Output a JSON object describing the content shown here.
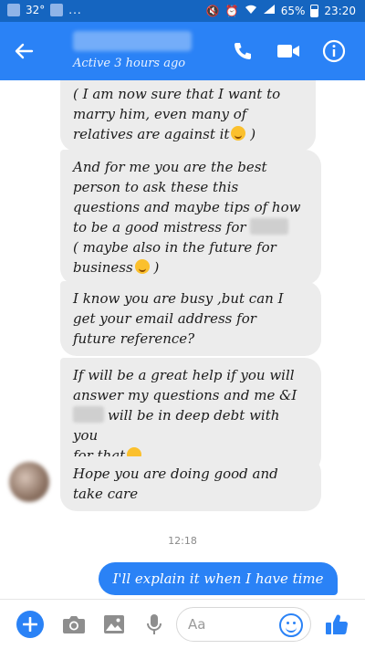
{
  "status_bar": {
    "temperature": "32°",
    "overflow_dots": "...",
    "battery_percent": "65%",
    "time": "23:20"
  },
  "header": {
    "status": "Active 3 hours ago",
    "icons": [
      "back-arrow-icon",
      "phone-icon",
      "video-camera-icon",
      "info-icon"
    ]
  },
  "messages": [
    {
      "id": "m1",
      "side": "received",
      "text": "( I am now sure that I want to\nmarry him, even many of\nrelatives are against it",
      "emoji": "winking-tongue-emoji",
      "after": " )"
    },
    {
      "id": "m2",
      "side": "received",
      "text": "And for me you are the best\nperson to ask these this\nquestions and maybe tips of how\nto be a good mistress for",
      "line2": "( maybe also in the future for\nbusiness",
      "emoji": "winking-tongue-emoji",
      "after": " )"
    },
    {
      "id": "m3",
      "side": "received",
      "text": "I know you are busy ,but can I\nget your email address for\nfuture reference?"
    },
    {
      "id": "m4",
      "side": "received",
      "text": "If will be a great help if you will\nanswer my questions and me &I",
      "line2": "will be in deep debt with you\nfor that",
      "emoji": "smiling-emoji"
    },
    {
      "id": "m5",
      "side": "received",
      "text": "Hope you are doing good and\ntake care"
    }
  ],
  "timestamp": "12:18",
  "sent_message": "I'll explain it when I have time",
  "composer": {
    "placeholder": "Aa"
  },
  "colors": {
    "status_bar": "#1565c0",
    "header": "#2a82f6",
    "received_bubble": "#ececec",
    "sent_bubble": "#2a82f6"
  }
}
